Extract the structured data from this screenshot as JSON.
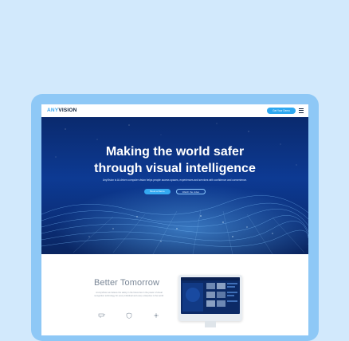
{
  "brand": {
    "logo_part1": "ANY",
    "logo_part2": "VISION"
  },
  "nav": {
    "cta_label": "Get Your Demo"
  },
  "hero": {
    "title_line1": "Making the world safer",
    "title_line2": "through visual intelligence",
    "subtitle": "AnyVision is AI-driven computer vision helps people access spaces, experiences and services with confidence and convenience.",
    "primary_button": "Book a Demo",
    "secondary_button": "Watch the video"
  },
  "section": {
    "title": "Better Tomorrow",
    "text": "At AnyVision we believe the safety in the future lies in the power of visual recognition technology for every individual and every enterprise in the world."
  },
  "colors": {
    "page_bg": "#d2e9fc",
    "device_frame": "#8ec8f6",
    "accent": "#2ea8f0",
    "hero_dark": "#0a2a6e"
  },
  "icons": [
    "hamburger-icon",
    "camera-icon",
    "shield-icon",
    "network-icon"
  ]
}
